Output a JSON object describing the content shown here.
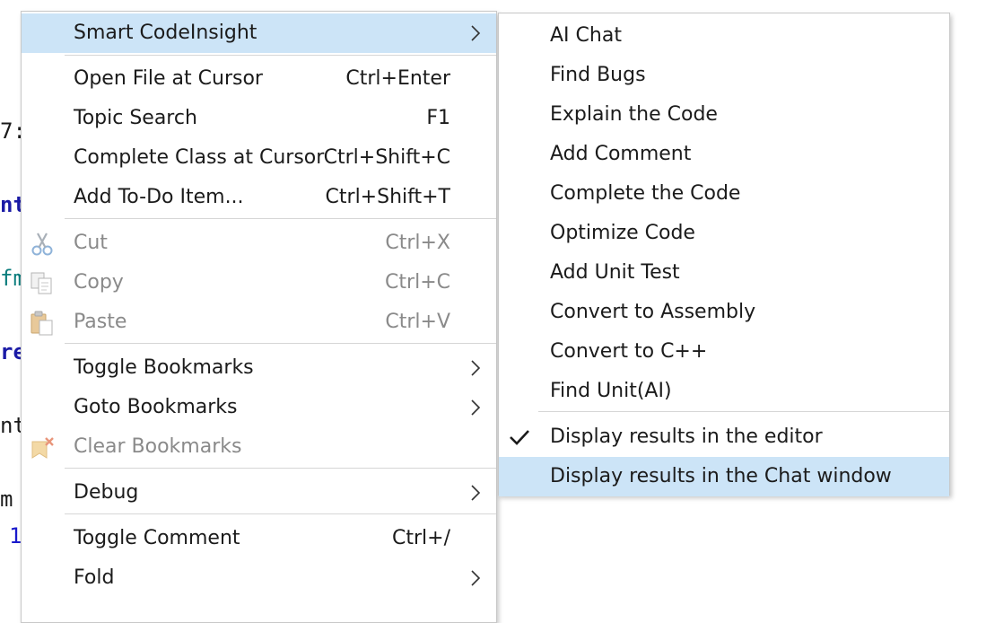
{
  "editor": {
    "lines": [
      {
        "text": "7:",
        "color": "#1b1b1b",
        "bold": false
      },
      {
        "text": "nt",
        "color": "#1a1aa6",
        "bold": true
      },
      {
        "text": "fm",
        "color": "#0b7d7d",
        "bold": false
      },
      {
        "text": "re",
        "color": "#1a1aa6",
        "bold": true
      },
      {
        "text": "nt",
        "color": "#1b1b1b",
        "bold": false
      },
      {
        "text": "m",
        "color": "#1b1b1b",
        "bold": false
      },
      {
        "text": "1",
        "color": "#1a1acc",
        "bold": false
      }
    ]
  },
  "context_menu": {
    "items": [
      {
        "label": "Smart CodeInsight",
        "submenu": true,
        "highlighted": true
      },
      {
        "label": "Open File at Cursor",
        "shortcut": "Ctrl+Enter"
      },
      {
        "label": "Topic Search",
        "shortcut": "F1"
      },
      {
        "label": "Complete Class at Cursor",
        "shortcut": "Ctrl+Shift+C"
      },
      {
        "label": "Add To-Do Item...",
        "shortcut": "Ctrl+Shift+T"
      },
      {
        "label": "Cut",
        "shortcut": "Ctrl+X",
        "disabled": true,
        "icon": "scissors-icon"
      },
      {
        "label": "Copy",
        "shortcut": "Ctrl+C",
        "disabled": true,
        "icon": "copy-icon"
      },
      {
        "label": "Paste",
        "shortcut": "Ctrl+V",
        "disabled": true,
        "icon": "paste-icon"
      },
      {
        "label": "Toggle Bookmarks",
        "submenu": true
      },
      {
        "label": "Goto Bookmarks",
        "submenu": true
      },
      {
        "label": "Clear Bookmarks",
        "disabled": true,
        "icon": "clear-bookmarks-icon"
      },
      {
        "label": "Debug",
        "submenu": true
      },
      {
        "label": "Toggle Comment",
        "shortcut": "Ctrl+/"
      },
      {
        "label": "Fold",
        "submenu": true
      }
    ]
  },
  "submenu": {
    "items": [
      {
        "label": "AI Chat"
      },
      {
        "label": "Find Bugs"
      },
      {
        "label": "Explain the Code"
      },
      {
        "label": "Add Comment"
      },
      {
        "label": "Complete the Code"
      },
      {
        "label": "Optimize Code"
      },
      {
        "label": "Add Unit Test"
      },
      {
        "label": "Convert to Assembly"
      },
      {
        "label": "Convert to C++"
      },
      {
        "label": "Find Unit(AI)"
      },
      {
        "label": "Display results in the editor",
        "checked": true
      },
      {
        "label": "Display results in the Chat window",
        "highlighted": true
      }
    ]
  },
  "colors": {
    "highlight": "#cce4f7",
    "disabled_text": "#8a8a8a",
    "text": "#1b1b1b"
  }
}
